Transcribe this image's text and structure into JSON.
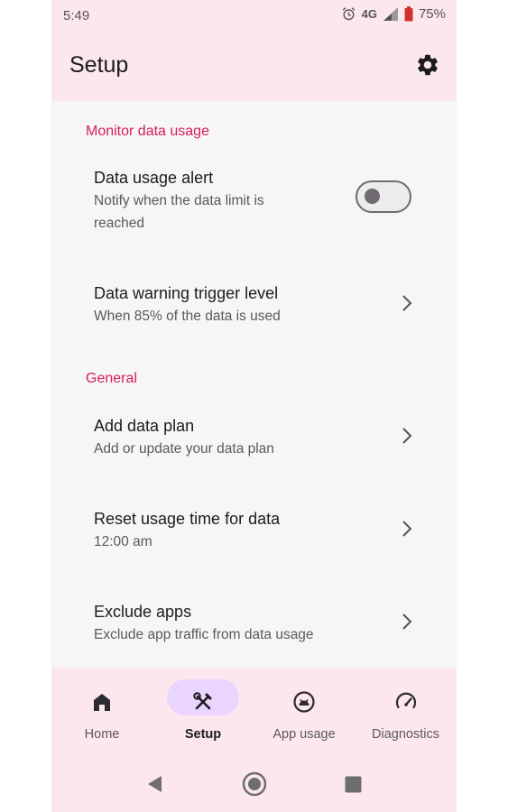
{
  "status_bar": {
    "time": "5:49",
    "network": "4G",
    "battery": "75%",
    "icons": [
      "alarm-icon",
      "signal-icon",
      "battery-icon"
    ]
  },
  "app_bar": {
    "title": "Setup",
    "settings_icon": "gear-icon"
  },
  "sections": [
    {
      "header": "Monitor data usage",
      "items": [
        {
          "title": "Data usage alert",
          "subtitle_line1": "Notify when the data limit is",
          "subtitle_line2": "reached",
          "control": "toggle",
          "toggle_on": false
        },
        {
          "title": "Data warning trigger level",
          "subtitle": "When 85% of the data is used",
          "control": "chevron"
        }
      ]
    },
    {
      "header": "General",
      "items": [
        {
          "title": "Add data plan",
          "subtitle": "Add or update your data plan",
          "control": "chevron"
        },
        {
          "title": "Reset usage time for data",
          "subtitle": "12:00 am",
          "control": "chevron"
        },
        {
          "title": "Exclude apps",
          "subtitle": "Exclude app traffic from data usage",
          "control": "chevron"
        }
      ]
    }
  ],
  "bottom_nav": {
    "active": "Setup",
    "items": [
      {
        "label": "Home",
        "icon": "home-icon"
      },
      {
        "label": "Setup",
        "icon": "tools-icon"
      },
      {
        "label": "App usage",
        "icon": "app-usage-icon"
      },
      {
        "label": "Diagnostics",
        "icon": "speedometer-icon"
      }
    ]
  },
  "system_nav": {
    "buttons": [
      "back-icon",
      "home-circle-icon",
      "recents-icon"
    ]
  },
  "colors": {
    "accent": "#d81b60",
    "bar_background": "#fde7ee",
    "content_background": "#f6f6f6",
    "active_pill": "#ead5ff"
  }
}
